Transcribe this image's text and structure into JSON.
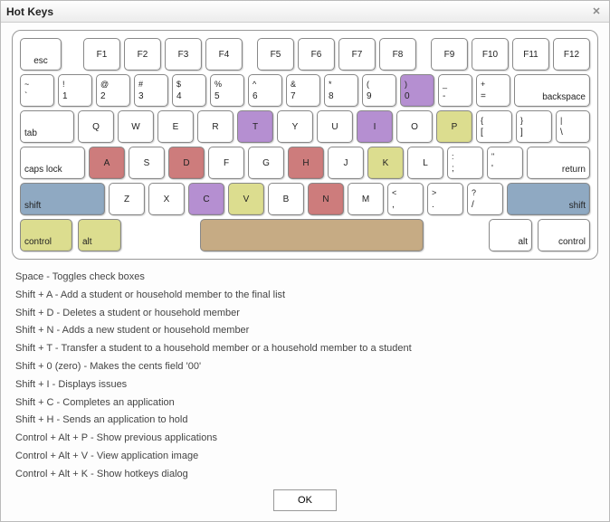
{
  "window": {
    "title": "Hot Keys"
  },
  "keyboard": {
    "row_fn": [
      "esc",
      "F1",
      "F2",
      "F3",
      "F4",
      "F5",
      "F6",
      "F7",
      "F8",
      "F9",
      "F10",
      "F11",
      "F12"
    ],
    "row_num": [
      {
        "u": "~",
        "l": "`"
      },
      {
        "u": "!",
        "l": "1"
      },
      {
        "u": "@",
        "l": "2"
      },
      {
        "u": "#",
        "l": "3"
      },
      {
        "u": "$",
        "l": "4"
      },
      {
        "u": "%",
        "l": "5"
      },
      {
        "u": "^",
        "l": "6"
      },
      {
        "u": "&",
        "l": "7"
      },
      {
        "u": "*",
        "l": "8"
      },
      {
        "u": "(",
        "l": "9"
      },
      {
        "u": ")",
        "l": "0"
      },
      {
        "u": "_",
        "l": "-"
      },
      {
        "u": "+",
        "l": "="
      }
    ],
    "backspace": "backspace",
    "tab": "tab",
    "row_q": [
      "Q",
      "W",
      "E",
      "R",
      "T",
      "Y",
      "U",
      "I",
      "O",
      "P"
    ],
    "row_q_brackets": [
      {
        "u": "{",
        "l": "["
      },
      {
        "u": "}",
        "l": "]"
      },
      {
        "u": "|",
        "l": "\\"
      }
    ],
    "capslock": "caps lock",
    "row_a": [
      "A",
      "S",
      "D",
      "F",
      "G",
      "H",
      "J",
      "K",
      "L"
    ],
    "row_a_punct": [
      {
        "u": ":",
        "l": ";"
      },
      {
        "u": "\"",
        "l": "'"
      }
    ],
    "return": "return",
    "shift": "shift",
    "row_z": [
      "Z",
      "X",
      "C",
      "V",
      "B",
      "N",
      "M"
    ],
    "row_z_punct": [
      {
        "u": "<",
        "l": ","
      },
      {
        "u": ">",
        "l": "."
      },
      {
        "u": "?",
        "l": "/"
      }
    ],
    "control": "control",
    "alt": "alt"
  },
  "shortcuts": [
    "Space - Toggles check boxes",
    "Shift + A - Add a student or household member to the final list",
    "Shift + D - Deletes a student or household member",
    "Shift + N - Adds a new student or household member",
    "Shift + T - Transfer a student to a household member or a household member to a student",
    "Shift + 0 (zero) - Makes the cents field '00'",
    "Shift + I - Displays issues",
    "Shift + C - Completes an application",
    "Shift + H - Sends an application to hold",
    "Control + Alt + P - Show previous applications",
    "Control + Alt + V - View application image",
    "Control + Alt + K - Show hotkeys dialog"
  ],
  "buttons": {
    "ok": "OK"
  }
}
